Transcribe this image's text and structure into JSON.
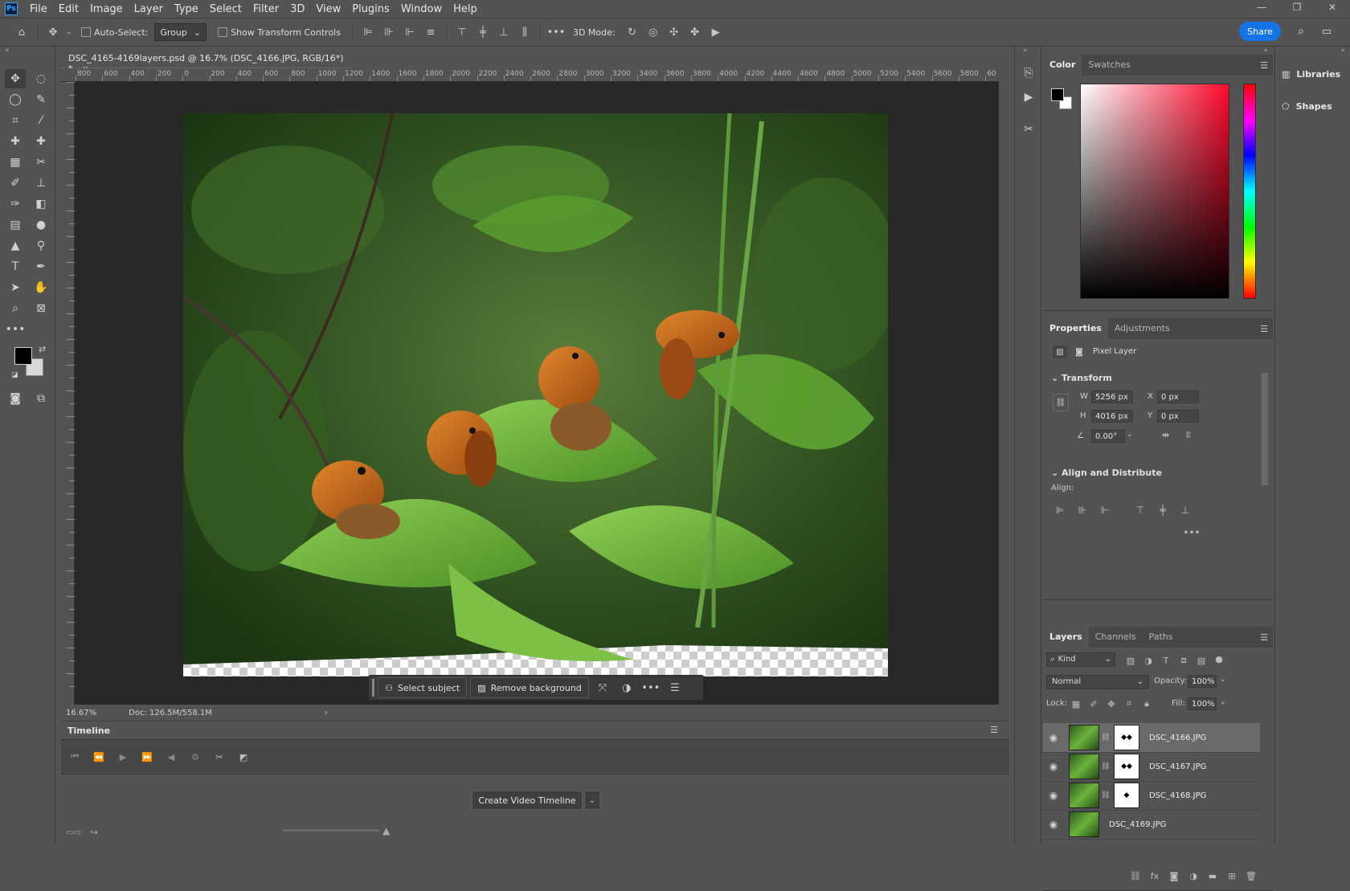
{
  "app": {
    "logo": "Ps"
  },
  "menu": [
    "File",
    "Edit",
    "Image",
    "Layer",
    "Type",
    "Select",
    "Filter",
    "3D",
    "View",
    "Plugins",
    "Window",
    "Help"
  ],
  "options_bar": {
    "auto_select_label": "Auto-Select:",
    "group_value": "Group",
    "show_transform_label": "Show Transform Controls",
    "mode_3d_label": "3D Mode:",
    "share_label": "Share"
  },
  "document": {
    "tab_title": "DSC_4165-4169layers.psd @ 16.7% (DSC_4166.JPG, RGB/16*) *",
    "close_glyph": "×",
    "zoom": "16.67%",
    "doc_size": "Doc: 126.5M/558.1M"
  },
  "ruler_h_ticks": [
    "800",
    "600",
    "400",
    "200",
    "0",
    "200",
    "400",
    "600",
    "800",
    "1000",
    "1200",
    "1400",
    "1600",
    "1800",
    "2000",
    "2200",
    "2400",
    "2600",
    "2800",
    "3000",
    "3200",
    "3400",
    "3600",
    "3800",
    "4000",
    "4200",
    "4400",
    "4600",
    "4800",
    "5000",
    "5200",
    "5400",
    "5600",
    "5800",
    "60"
  ],
  "contextual_bar": {
    "select_subject": "Select subject",
    "remove_background": "Remove background"
  },
  "timeline": {
    "title": "Timeline",
    "create_button": "Create Video Timeline"
  },
  "color_panel": {
    "tabs": [
      "Color",
      "Swatches"
    ],
    "foreground": "#000000",
    "background": "#ffffff"
  },
  "properties_panel": {
    "tabs": [
      "Properties",
      "Adjustments"
    ],
    "layer_type": "Pixel Layer",
    "transform_title": "Transform",
    "w_label": "W",
    "w_value": "5256 px",
    "h_label": "H",
    "h_value": "4016 px",
    "x_label": "X",
    "x_value": "0 px",
    "y_label": "Y",
    "y_value": "0 px",
    "angle_value": "0.00°",
    "align_title": "Align and Distribute",
    "align_label": "Align:"
  },
  "layers_panel": {
    "tabs": [
      "Layers",
      "Channels",
      "Paths"
    ],
    "filter_kind": "Kind",
    "blend_mode": "Normal",
    "opacity_label": "Opacity:",
    "opacity_value": "100%",
    "lock_label": "Lock:",
    "fill_label": "Fill:",
    "fill_value": "100%",
    "layers": [
      {
        "name": "DSC_4166.JPG",
        "has_mask": true,
        "selected": true
      },
      {
        "name": "DSC_4167.JPG",
        "has_mask": true,
        "selected": false
      },
      {
        "name": "DSC_4168.JPG",
        "has_mask": true,
        "selected": false
      },
      {
        "name": "DSC_4169.JPG",
        "has_mask": false,
        "selected": false
      }
    ]
  },
  "libraries": {
    "libraries_label": "Libraries",
    "shapes_label": "Shapes"
  },
  "colors": {
    "accent": "#1473e6",
    "panel_bg": "#535353",
    "canvas_bg": "#282828"
  }
}
